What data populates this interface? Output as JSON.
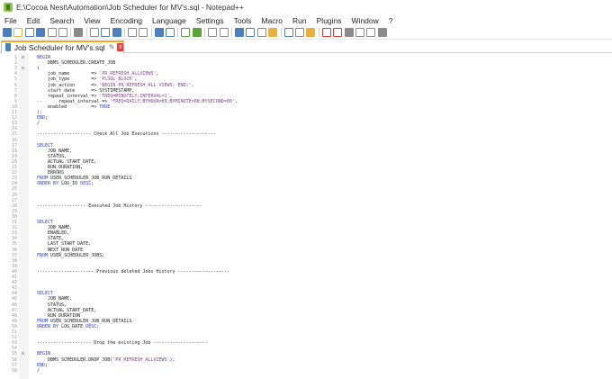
{
  "window": {
    "title": "E:\\Cocoa Nest\\Automation\\Job Scheduler for MV's.sql - Notepad++"
  },
  "menu": [
    "File",
    "Edit",
    "Search",
    "View",
    "Encoding",
    "Language",
    "Settings",
    "Tools",
    "Macro",
    "Run",
    "Plugins",
    "Window",
    "?"
  ],
  "toolbar": {
    "icons": [
      "new-file-icon",
      "open-file-icon",
      "save-icon",
      "save-all-icon",
      "close-icon",
      "close-all-icon",
      "print-icon",
      "cut-icon",
      "copy-icon",
      "paste-icon",
      "undo-icon",
      "redo-icon",
      "find-icon",
      "replace-icon",
      "zoom-in-icon",
      "zoom-out-icon",
      "sync-vertical-icon",
      "sync-horizontal-icon",
      "word-wrap-icon",
      "show-all-chars-icon",
      "indent-guide-icon",
      "user-defined-lang-icon",
      "doc-map-icon",
      "function-list-icon",
      "folder-workspace-icon",
      "monitoring-icon",
      "record-macro-icon",
      "stop-record-icon",
      "play-macro-icon",
      "run-macro-multiple-icon",
      "save-macro-icon"
    ],
    "colors": {
      "blue": "#4a7fc1",
      "green": "#5aa33c",
      "red": "#d93b3b",
      "yellow": "#e8b13a",
      "gray": "#8a8a8a"
    }
  },
  "tab": {
    "label": "Job Scheduler for MV's.sql",
    "pin": "✎",
    "close": "x"
  },
  "editor": {
    "lines": [
      {
        "n": "1",
        "fold": "⊟",
        "code": [
          [
            "kw",
            "BEGIN"
          ]
        ]
      },
      {
        "n": "2",
        "fold": "",
        "code": [
          [
            "",
            "    DBMS_SCHEDULER.CREATE_JOB"
          ]
        ]
      },
      {
        "n": "3",
        "fold": "⊟",
        "code": [
          [
            "op",
            "("
          ]
        ]
      },
      {
        "n": "4",
        "fold": "",
        "code": [
          [
            "",
            "    job_name        => "
          ],
          [
            "str",
            "'PR_REFRESH_ALLVIEWS'"
          ],
          [
            "op",
            ","
          ]
        ]
      },
      {
        "n": "5",
        "fold": "",
        "code": [
          [
            "",
            "    job_type        => "
          ],
          [
            "str",
            "'PLSQL_BLOCK'"
          ],
          [
            "op",
            ","
          ]
        ]
      },
      {
        "n": "6",
        "fold": "",
        "code": [
          [
            "",
            "    job_action      => "
          ],
          [
            "str",
            "'BEGIN PR_REFRESH_ALL_VIEWS; END;'"
          ],
          [
            "op",
            ","
          ]
        ]
      },
      {
        "n": "7",
        "fold": "",
        "code": [
          [
            "",
            "    start_date      => SYSTIMESTAMP,"
          ]
        ]
      },
      {
        "n": "8",
        "fold": "",
        "code": [
          [
            "",
            "    repeat_interval => "
          ],
          [
            "str",
            "'FREQ=MINUTELY;INTERVAL=1'"
          ],
          [
            "op",
            ","
          ]
        ]
      },
      {
        "n": "9",
        "fold": "",
        "code": [
          [
            "cmt",
            "--"
          ],
          [
            "",
            "      repeat_interval => "
          ],
          [
            "str",
            "'FREQ=DAILY;BYHOUR=09;BYMINUTE=00;BYSECOND=00'"
          ],
          [
            "op",
            ","
          ]
        ]
      },
      {
        "n": "10",
        "fold": "",
        "code": [
          [
            "",
            "    enabled         => "
          ],
          [
            "kw",
            "TRUE"
          ]
        ]
      },
      {
        "n": "11",
        "fold": "",
        "code": [
          [
            "op",
            ");"
          ]
        ]
      },
      {
        "n": "12",
        "fold": "",
        "code": [
          [
            "kw",
            "END"
          ],
          [
            "op",
            ";"
          ]
        ]
      },
      {
        "n": "13",
        "fold": "",
        "code": [
          [
            "op",
            "/"
          ]
        ]
      },
      {
        "n": "14",
        "fold": "",
        "code": [
          [
            "",
            ""
          ]
        ]
      },
      {
        "n": "15",
        "fold": "",
        "code": [
          [
            "",
            "-------------------- Check All Job Executions --------------------"
          ]
        ]
      },
      {
        "n": "16",
        "fold": "",
        "code": [
          [
            "",
            ""
          ]
        ]
      },
      {
        "n": "17",
        "fold": "",
        "code": [
          [
            "kw",
            "SELECT"
          ]
        ]
      },
      {
        "n": "18",
        "fold": "",
        "code": [
          [
            "",
            "    JOB_NAME,"
          ]
        ]
      },
      {
        "n": "19",
        "fold": "",
        "code": [
          [
            "",
            "    STATUS,"
          ]
        ]
      },
      {
        "n": "20",
        "fold": "",
        "code": [
          [
            "",
            "    ACTUAL_START_DATE,"
          ]
        ]
      },
      {
        "n": "21",
        "fold": "",
        "code": [
          [
            "",
            "    RUN_DURATION,"
          ]
        ]
      },
      {
        "n": "22",
        "fold": "",
        "code": [
          [
            "",
            "    ERRORS"
          ]
        ]
      },
      {
        "n": "23",
        "fold": "",
        "code": [
          [
            "kw",
            "FROM"
          ],
          [
            "",
            " USER_SCHEDULER_JOB_RUN_DETAILS"
          ]
        ]
      },
      {
        "n": "24",
        "fold": "",
        "code": [
          [
            "kw",
            "ORDER BY"
          ],
          [
            "",
            " LOG_ID "
          ],
          [
            "kw",
            "DESC"
          ],
          [
            "op",
            ";"
          ]
        ]
      },
      {
        "n": "25",
        "fold": "",
        "code": [
          [
            "",
            ""
          ]
        ]
      },
      {
        "n": "26",
        "fold": "",
        "code": [
          [
            "",
            ""
          ]
        ]
      },
      {
        "n": "27",
        "fold": "",
        "code": [
          [
            "",
            ""
          ]
        ]
      },
      {
        "n": "28",
        "fold": "",
        "code": [
          [
            "",
            "------------------ Executed Job History ---------------------"
          ]
        ]
      },
      {
        "n": "29",
        "fold": "",
        "code": [
          [
            "",
            ""
          ]
        ]
      },
      {
        "n": "30",
        "fold": "",
        "code": [
          [
            "",
            ""
          ]
        ]
      },
      {
        "n": "31",
        "fold": "",
        "code": [
          [
            "kw",
            "SELECT"
          ]
        ]
      },
      {
        "n": "32",
        "fold": "",
        "code": [
          [
            "",
            "    JOB_NAME,"
          ]
        ]
      },
      {
        "n": "33",
        "fold": "",
        "code": [
          [
            "",
            "    ENABLED,"
          ]
        ]
      },
      {
        "n": "34",
        "fold": "",
        "code": [
          [
            "",
            "    STATE,"
          ]
        ]
      },
      {
        "n": "35",
        "fold": "",
        "code": [
          [
            "",
            "    LAST_START_DATE,"
          ]
        ]
      },
      {
        "n": "36",
        "fold": "",
        "code": [
          [
            "",
            "    NEXT_RUN_DATE"
          ]
        ]
      },
      {
        "n": "37",
        "fold": "",
        "code": [
          [
            "kw",
            "FROM"
          ],
          [
            "",
            " USER_SCHEDULER_JOBS;"
          ]
        ]
      },
      {
        "n": "38",
        "fold": "",
        "code": [
          [
            "",
            ""
          ]
        ]
      },
      {
        "n": "39",
        "fold": "",
        "code": [
          [
            "",
            ""
          ]
        ]
      },
      {
        "n": "40",
        "fold": "",
        "code": [
          [
            "",
            "--------------------- Previous deleted Jobs History -------------------"
          ]
        ]
      },
      {
        "n": "41",
        "fold": "",
        "code": [
          [
            "",
            ""
          ]
        ]
      },
      {
        "n": "42",
        "fold": "",
        "code": [
          [
            "",
            ""
          ]
        ]
      },
      {
        "n": "43",
        "fold": "",
        "code": [
          [
            "",
            ""
          ]
        ]
      },
      {
        "n": "44",
        "fold": "",
        "code": [
          [
            "kw",
            "SELECT"
          ]
        ]
      },
      {
        "n": "45",
        "fold": "",
        "code": [
          [
            "",
            "    JOB_NAME,"
          ]
        ]
      },
      {
        "n": "46",
        "fold": "",
        "code": [
          [
            "",
            "    STATUS,"
          ]
        ]
      },
      {
        "n": "47",
        "fold": "",
        "code": [
          [
            "",
            "    ACTUAL_START_DATE,"
          ]
        ]
      },
      {
        "n": "48",
        "fold": "",
        "code": [
          [
            "",
            "    RUN_DURATION"
          ]
        ]
      },
      {
        "n": "49",
        "fold": "",
        "code": [
          [
            "kw",
            "FROM"
          ],
          [
            "",
            " USER_SCHEDULER_JOB_RUN_DETAILS"
          ]
        ]
      },
      {
        "n": "50",
        "fold": "",
        "code": [
          [
            "kw",
            "ORDER BY"
          ],
          [
            "",
            " LOG_DATE "
          ],
          [
            "kw",
            "DESC"
          ],
          [
            "op",
            ";"
          ]
        ]
      },
      {
        "n": "51",
        "fold": "",
        "code": [
          [
            "",
            ""
          ]
        ]
      },
      {
        "n": "52",
        "fold": "",
        "code": [
          [
            "",
            ""
          ]
        ]
      },
      {
        "n": "53",
        "fold": "",
        "code": [
          [
            "",
            "-------------------- Drop the existing Job --------------------"
          ]
        ]
      },
      {
        "n": "54",
        "fold": "",
        "code": [
          [
            "",
            ""
          ]
        ]
      },
      {
        "n": "55",
        "fold": "⊟",
        "code": [
          [
            "kw",
            "BEGIN"
          ]
        ]
      },
      {
        "n": "56",
        "fold": "",
        "code": [
          [
            "",
            "    DBMS_SCHEDULER.DROP_JOB("
          ],
          [
            "str",
            "'PR_REFRESH_ALLVIEWS'"
          ],
          [
            "op",
            ");"
          ]
        ]
      },
      {
        "n": "57",
        "fold": "",
        "code": [
          [
            "kw",
            "END"
          ],
          [
            "op",
            ";"
          ]
        ]
      },
      {
        "n": "58",
        "fold": "",
        "code": [
          [
            "op",
            "/"
          ]
        ]
      }
    ]
  }
}
